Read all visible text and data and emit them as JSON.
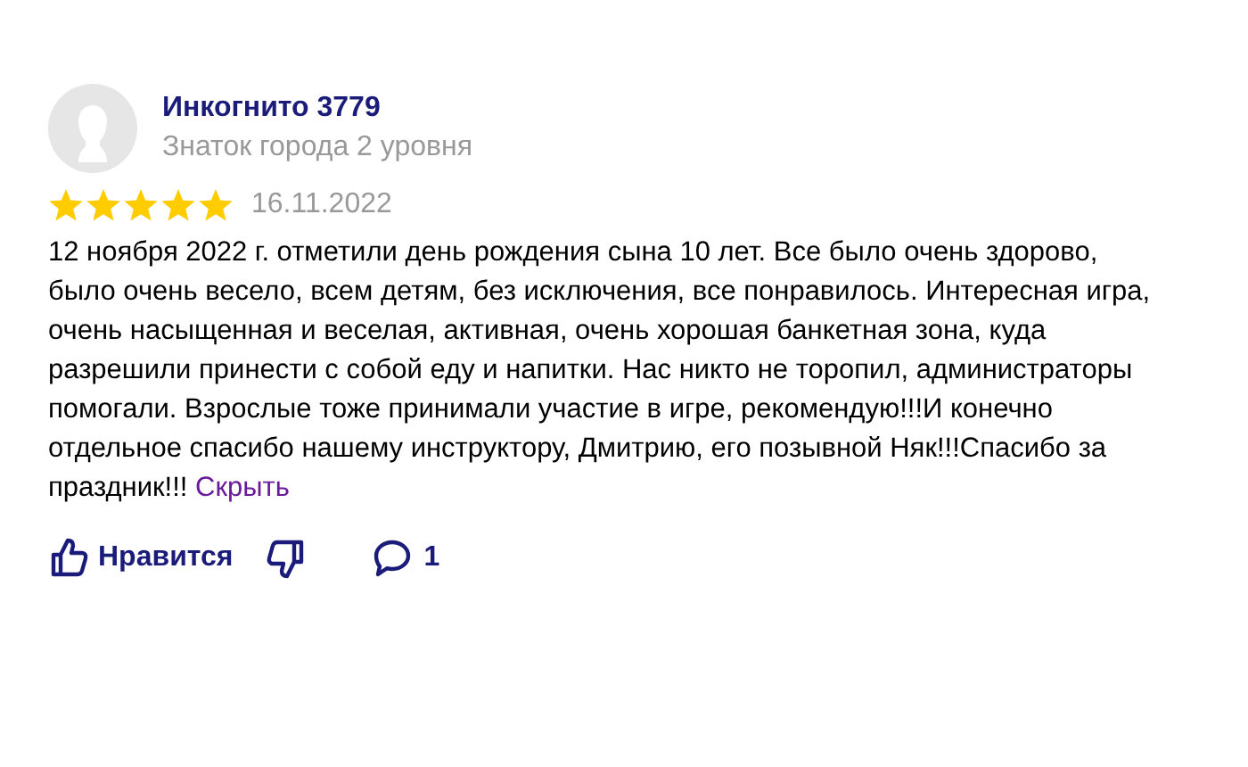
{
  "review": {
    "author": "Инкогнито 3779",
    "rank": "Знаток города 2 уровня",
    "stars": 5,
    "date": "16.11.2022",
    "text": "12 ноября 2022 г. отметили день рождения сына 10 лет. Все было очень здорово, было очень весело, всем детям, без исключения, все понравилось. Интересная игра, очень насыщенная и веселая, активная, очень хорошая банкетная зона, куда разрешили принести с собой еду и напитки. Нас никто не торопил, администраторы помогали. Взрослые тоже принимали участие в игре, рекомендую!!!И конечно отдельное спасибо нашему инструктору, Дмитрию, его позывной Няк!!!Спасибо за праздник!!!",
    "hide_link": "Скрыть"
  },
  "actions": {
    "like": "Нравится",
    "comments": "1"
  }
}
